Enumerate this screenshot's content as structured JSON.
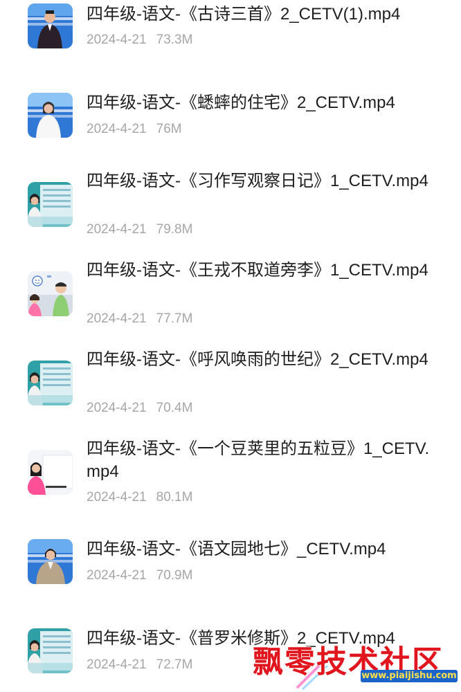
{
  "files": [
    {
      "name": "四年级-语文-《古诗三首》2_CETV(1).mp4",
      "date": "2024-4-21",
      "size": "73.3M",
      "thumb": "teacher-male-dark"
    },
    {
      "name": "四年级-语文-《蟋蟀的住宅》2_CETV.mp4",
      "date": "2024-4-21",
      "size": "76M",
      "thumb": "teacher-female-white"
    },
    {
      "name": "四年级-语文-《习作写观察日记》1_CETV.mp4",
      "date": "2024-4-21",
      "size": "79.8M",
      "thumb": "studio-teal"
    },
    {
      "name": "四年级-语文-《王戎不取道旁李》1_CETV.mp4",
      "date": "2024-4-21",
      "size": "77.7M",
      "thumb": "cartoon-kids"
    },
    {
      "name": "四年级-语文-《呼风唤雨的世纪》2_CETV.mp4",
      "date": "2024-4-21",
      "size": "70.4M",
      "thumb": "studio-teal"
    },
    {
      "name": "四年级-语文-《一个豆荚里的五粒豆》1_CETV.mp4",
      "date": "2024-4-21",
      "size": "80.1M",
      "thumb": "teacher-female-light"
    },
    {
      "name": "四年级-语文-《语文园地七》_CETV.mp4",
      "date": "2024-4-21",
      "size": "70.9M",
      "thumb": "teacher-female-blazer"
    },
    {
      "name": "四年级-语文-《普罗米修斯》2_CETV.mp4",
      "date": "2024-4-21",
      "size": "72.7M",
      "thumb": "studio-teal"
    }
  ],
  "watermark": {
    "text": "飘零技术社区",
    "url": "www.piaijishu.com"
  }
}
